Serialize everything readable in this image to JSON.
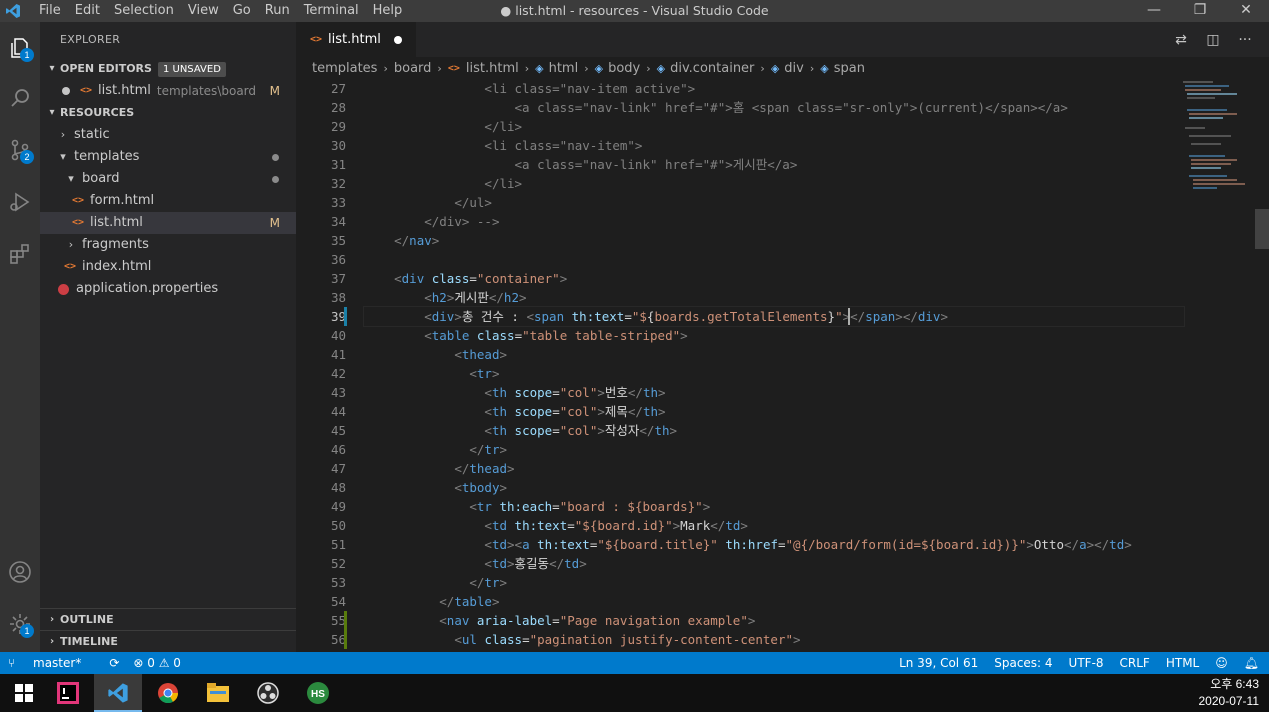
{
  "titlebar": {
    "menu": [
      "File",
      "Edit",
      "Selection",
      "View",
      "Go",
      "Run",
      "Terminal",
      "Help"
    ],
    "window_title": "● list.html - resources - Visual Studio Code",
    "controls": [
      "—",
      "❐",
      "✕"
    ]
  },
  "activitybar": {
    "explorer_badge": "1",
    "scm_badge": "2",
    "settings_badge": "1"
  },
  "sidebar": {
    "title": "EXPLORER",
    "open_editors": {
      "label": "OPEN EDITORS",
      "badge": "1 UNSAVED",
      "file": "list.html",
      "path": "templates\\board",
      "status": "M"
    },
    "resources_label": "RESOURCES",
    "tree": [
      {
        "label": "static",
        "status": ""
      },
      {
        "label": "templates",
        "status": "dot"
      },
      {
        "label": "board",
        "status": "dot"
      },
      {
        "label": "form.html",
        "status": ""
      },
      {
        "label": "list.html",
        "status": "M"
      },
      {
        "label": "fragments",
        "status": ""
      },
      {
        "label": "index.html",
        "status": ""
      },
      {
        "label": "application.properties",
        "status": ""
      }
    ],
    "outline_label": "OUTLINE",
    "timeline_label": "TIMELINE"
  },
  "tab": {
    "name": "list.html",
    "icon": "<>"
  },
  "breadcrumb": [
    "templates",
    "board",
    "list.html",
    "html",
    "body",
    "div.container",
    "div",
    "span"
  ],
  "editor": {
    "line_numbers": [
      "27",
      "28",
      "29",
      "30",
      "31",
      "32",
      "33",
      "34",
      "35",
      "36",
      "37",
      "38",
      "39",
      "40",
      "41",
      "42",
      "43",
      "44",
      "45",
      "46",
      "47",
      "48",
      "49",
      "50",
      "51",
      "52",
      "53",
      "54",
      "55",
      "56"
    ],
    "current_line": "39"
  },
  "statusbar": {
    "branch": "master*",
    "sync": "⟳",
    "problems": "⊗ 0 ⚠ 0",
    "position": "Ln 39, Col 61",
    "spaces": "Spaces: 4",
    "encoding": "UTF-8",
    "eol": "CRLF",
    "language": "HTML"
  },
  "taskbar": {
    "time": "오후 6:43",
    "date": "2020-07-11"
  },
  "colors": {
    "accent": "#007acc",
    "modified": "#e2c08d",
    "html_icon": "#e37933"
  }
}
